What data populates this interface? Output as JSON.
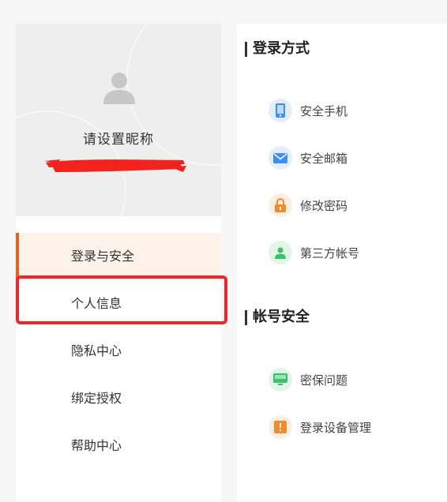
{
  "profile": {
    "nickname": "请设置昵称"
  },
  "menu": {
    "items": [
      {
        "label": "登录与安全"
      },
      {
        "label": "个人信息"
      },
      {
        "label": "隐私中心"
      },
      {
        "label": "绑定授权"
      },
      {
        "label": "帮助中心"
      }
    ]
  },
  "login_methods": {
    "title": "登录方式",
    "items": [
      {
        "label": "安全手机",
        "icon": "phone-icon"
      },
      {
        "label": "安全邮箱",
        "icon": "mail-icon"
      },
      {
        "label": "修改密码",
        "icon": "lock-icon"
      },
      {
        "label": "第三方帐号",
        "icon": "person-icon"
      }
    ]
  },
  "account_security": {
    "title": "帐号安全",
    "items": [
      {
        "label": "密保问题",
        "icon": "monitor-icon"
      },
      {
        "label": "登录设备管理",
        "icon": "alert-icon"
      }
    ]
  },
  "colors": {
    "accent": "#e8601c",
    "highlight": "#f0242b",
    "active_bg": "#fdf3ea"
  }
}
